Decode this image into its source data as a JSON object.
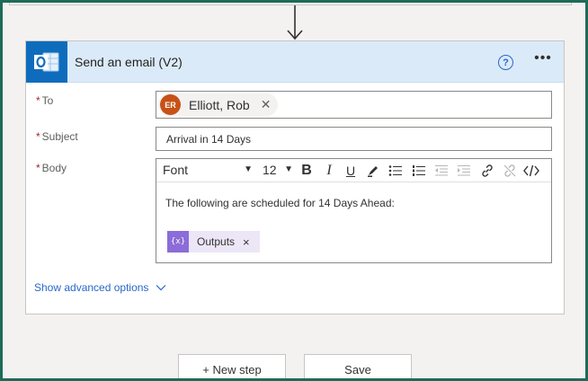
{
  "step": {
    "title": "Send an email (V2)",
    "help_icon": "question-icon",
    "more_icon": "ellipsis-icon",
    "app_icon": "outlook-icon",
    "header_color": "#dbeaf8",
    "app_color": "#0f6cbd"
  },
  "fields": {
    "to": {
      "label": "To",
      "required": "*",
      "recipient": {
        "initials": "ER",
        "name": "Elliott, Rob",
        "avatar_color": "#c75116"
      },
      "remove_glyph": "✕"
    },
    "subject": {
      "label": "Subject",
      "required": "*",
      "value": "Arrival in 14 Days"
    },
    "body": {
      "label": "Body",
      "required": "*",
      "toolbar": {
        "font": "Font",
        "font_size": "12",
        "bold": "B",
        "italic": "I",
        "underline": "U"
      },
      "text": "The following are scheduled for 14 Days Ahead:",
      "token": {
        "icon_text": "{x}",
        "label": "Outputs",
        "remove_glyph": "×",
        "color": "#8c6cd8"
      }
    }
  },
  "advanced_link": "Show advanced options",
  "buttons": {
    "new_step": "+ New step",
    "save": "Save"
  },
  "colors": {
    "frame": "#1f6b57",
    "link": "#2a67c9",
    "required": "#a4262c"
  }
}
